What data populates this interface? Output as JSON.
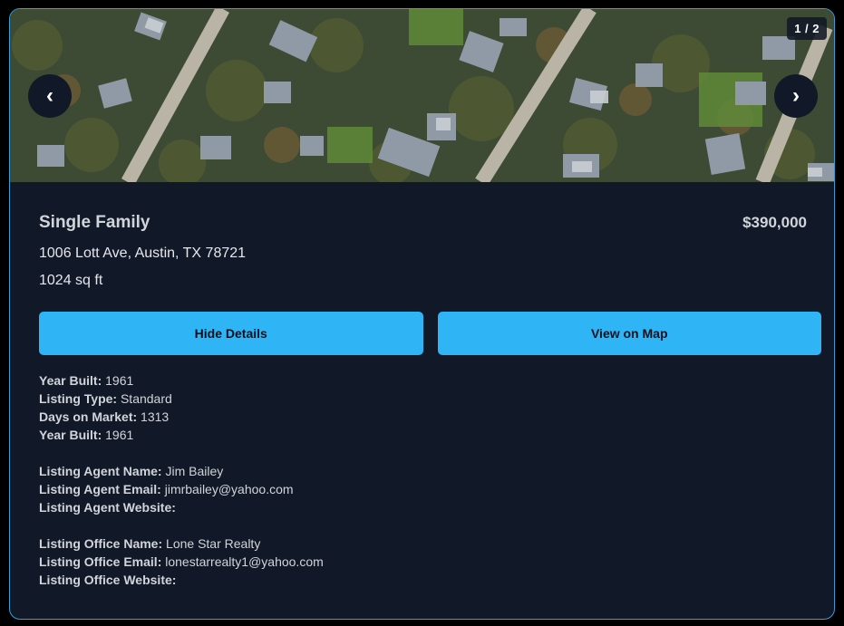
{
  "gallery": {
    "counter": "1 / 2",
    "prev_label": "‹",
    "next_label": "›"
  },
  "listing": {
    "type": "Single Family",
    "price": "$390,000",
    "address": "1006 Lott Ave, Austin, TX 78721",
    "sqft": "1024 sq ft"
  },
  "actions": {
    "hide_details": "Hide Details",
    "view_on_map": "View on Map"
  },
  "details": {
    "property": [
      {
        "label": "Year Built:",
        "value": "1961"
      },
      {
        "label": "Listing Type:",
        "value": "Standard"
      },
      {
        "label": "Days on Market:",
        "value": "1313"
      },
      {
        "label": "Year Built:",
        "value": "1961"
      }
    ],
    "agent": [
      {
        "label": "Listing Agent Name:",
        "value": "Jim Bailey"
      },
      {
        "label": "Listing Agent Email:",
        "value": "jimrbailey@yahoo.com"
      },
      {
        "label": "Listing Agent Website:",
        "value": ""
      }
    ],
    "office": [
      {
        "label": "Listing Office Name:",
        "value": "Lone Star Realty"
      },
      {
        "label": "Listing Office Email:",
        "value": "lonestarrealty1@yahoo.com"
      },
      {
        "label": "Listing Office Website:",
        "value": ""
      }
    ]
  },
  "colors": {
    "card_bg": "#111827",
    "accent_button": "#2fb5f5",
    "border": "#3b9dd6"
  }
}
